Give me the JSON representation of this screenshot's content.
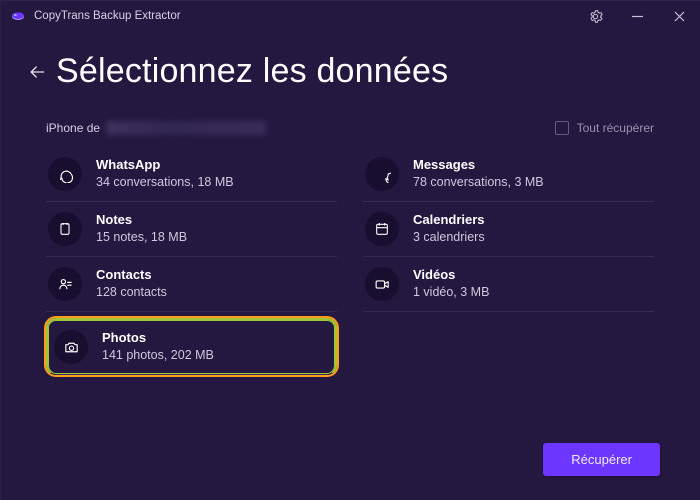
{
  "titlebar": {
    "app_name": "CopyTrans Backup Extractor"
  },
  "header": {
    "page_title": "Sélectionnez les données"
  },
  "device": {
    "prefix": "iPhone de"
  },
  "recall": {
    "label": "Tout récupérer"
  },
  "items": {
    "whatsapp": {
      "title": "WhatsApp",
      "sub": "34 conversations, 18 MB"
    },
    "notes": {
      "title": "Notes",
      "sub": "15 notes, 18 MB"
    },
    "contacts": {
      "title": "Contacts",
      "sub": "128 contacts"
    },
    "photos": {
      "title": "Photos",
      "sub": "141 photos, 202 MB"
    },
    "messages": {
      "title": "Messages",
      "sub": "78 conversations, 3 MB"
    },
    "calendars": {
      "title": "Calendriers",
      "sub": "3 calendriers"
    },
    "videos": {
      "title": "Vidéos",
      "sub": "1 vidéo, 3 MB"
    }
  },
  "actions": {
    "recover": "Récupérer"
  }
}
